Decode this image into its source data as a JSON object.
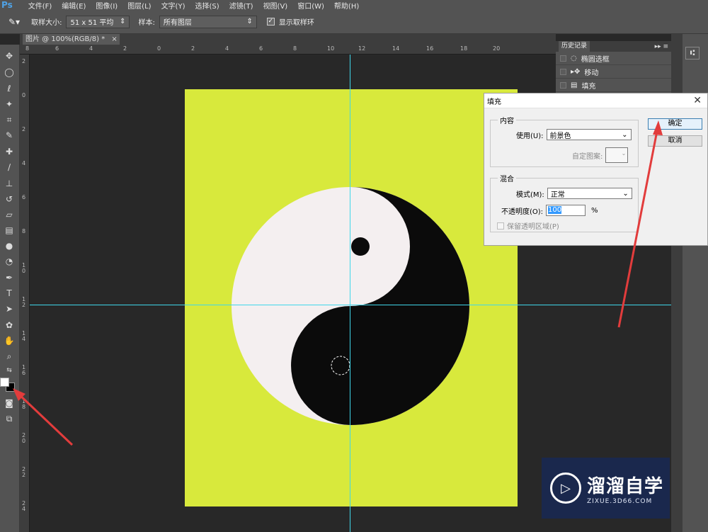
{
  "menubar": {
    "app_logo": "Ps",
    "items": [
      "文件(F)",
      "编辑(E)",
      "图像(I)",
      "图层(L)",
      "文字(Y)",
      "选择(S)",
      "滤镜(T)",
      "视图(V)",
      "窗口(W)",
      "帮助(H)"
    ]
  },
  "options_bar": {
    "sample_size_label": "取样大小:",
    "sample_size_value": "51 x 51 平均",
    "sample_label": "样本:",
    "sample_value": "所有图层",
    "show_ring_label": "显示取样环",
    "show_ring_checked": true
  },
  "document_tab": {
    "label": "图片 @ 100%(RGB/8) *",
    "close": "×"
  },
  "rulers": {
    "top_ticks": [
      "8",
      "6",
      "4",
      "2",
      "0",
      "2",
      "4",
      "6",
      "8",
      "10",
      "12",
      "14",
      "16",
      "18",
      "20"
    ],
    "left_ticks": [
      "2",
      "0",
      "2",
      "4",
      "6",
      "8",
      "1 0",
      "1 2",
      "1 4",
      "1 6",
      "1 8",
      "2 0",
      "2 2",
      "2 4"
    ]
  },
  "history_panel": {
    "title": "历史记录",
    "items": [
      {
        "label": "椭圆选框",
        "icon": "ellipse-marquee-icon"
      },
      {
        "label": "移动",
        "icon": "move-icon"
      },
      {
        "label": "填充",
        "icon": "fill-icon"
      }
    ]
  },
  "fill_dialog": {
    "title": "填充",
    "content_group": "内容",
    "use_label": "使用(U):",
    "use_value": "前景色",
    "custom_pattern_label": "自定图案:",
    "blend_group": "混合",
    "mode_label": "模式(M):",
    "mode_value": "正常",
    "opacity_label": "不透明度(O):",
    "opacity_value": "100",
    "opacity_unit": "%",
    "preserve_transparency_label": "保留透明区域(P)",
    "preserve_transparency_checked": false,
    "ok_label": "确定",
    "cancel_label": "取消"
  },
  "watermark": {
    "title": "溜溜自学",
    "url": "ZIXUE.3D66.COM"
  },
  "colors": {
    "canvas": "#d8e93c",
    "guide": "#3fd6ea",
    "arrow": "#e23c3c",
    "foreground": "#ffffff",
    "background": "#000000"
  }
}
